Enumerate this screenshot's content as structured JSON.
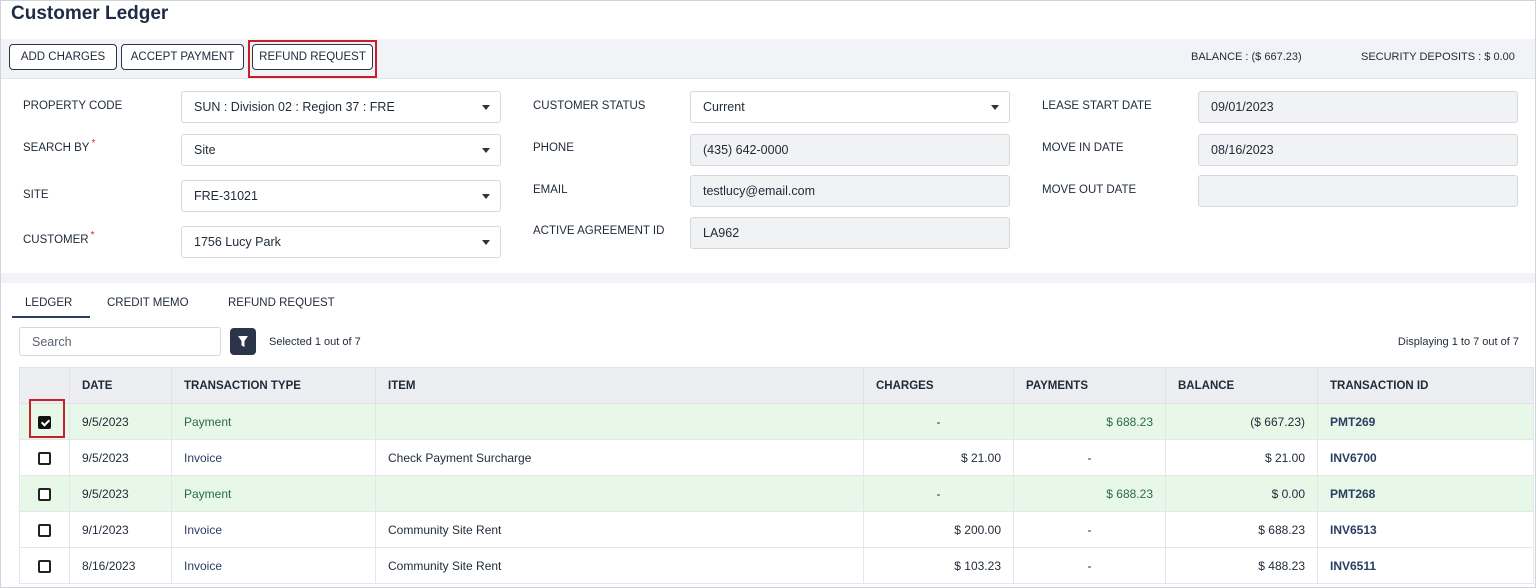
{
  "page": {
    "title": "Customer Ledger"
  },
  "toolbar": {
    "add_charges": "ADD CHARGES",
    "accept_payment": "ACCEPT PAYMENT",
    "refund_request": "REFUND REQUEST",
    "balance": "BALANCE : ($ 667.23)",
    "security_deposits": "SECURITY DEPOSITS : $ 0.00"
  },
  "form": {
    "property_code": {
      "label": "PROPERTY CODE",
      "value": "SUN : Division 02 : Region 37 : FRE"
    },
    "search_by": {
      "label": "SEARCH BY",
      "value": "Site"
    },
    "site": {
      "label": "SITE",
      "value": "FRE-31021"
    },
    "customer": {
      "label": "CUSTOMER",
      "value": "1756 Lucy Park"
    },
    "customer_status": {
      "label": "CUSTOMER STATUS",
      "value": "Current"
    },
    "phone": {
      "label": "PHONE",
      "value": "(435) 642-0000"
    },
    "email": {
      "label": "EMAIL",
      "value": "testlucy@email.com"
    },
    "active_agreement_id": {
      "label": "ACTIVE AGREEMENT ID",
      "value": "LA962"
    },
    "lease_start_date": {
      "label": "LEASE START DATE",
      "value": "09/01/2023"
    },
    "move_in_date": {
      "label": "MOVE IN DATE",
      "value": "08/16/2023"
    },
    "move_out_date": {
      "label": "MOVE OUT DATE",
      "value": ""
    },
    "required_marker": "*"
  },
  "tabs": [
    {
      "label": "LEDGER",
      "active": true
    },
    {
      "label": "CREDIT MEMO",
      "active": false
    },
    {
      "label": "REFUND REQUEST",
      "active": false
    }
  ],
  "grid_toolbar": {
    "search_placeholder": "Search",
    "selected_info": "Selected 1 out of 7",
    "display_info": "Displaying 1 to 7 out of 7"
  },
  "table": {
    "columns": [
      "DATE",
      "TRANSACTION TYPE",
      "ITEM",
      "CHARGES",
      "PAYMENTS",
      "BALANCE",
      "TRANSACTION ID"
    ],
    "rows": [
      {
        "checked": true,
        "date": "9/5/2023",
        "type": "Payment",
        "item": "",
        "charges": "-",
        "payments": "$ 688.23",
        "balance": "($ 667.23)",
        "txid": "PMT269"
      },
      {
        "checked": false,
        "date": "9/5/2023",
        "type": "Invoice",
        "item": "Check Payment Surcharge",
        "charges": "$ 21.00",
        "payments": "-",
        "balance": "$ 21.00",
        "txid": "INV6700"
      },
      {
        "checked": false,
        "date": "9/5/2023",
        "type": "Payment",
        "item": "",
        "charges": "-",
        "payments": "$ 688.23",
        "balance": "$ 0.00",
        "txid": "PMT268"
      },
      {
        "checked": false,
        "date": "9/1/2023",
        "type": "Invoice",
        "item": "Community Site Rent",
        "charges": "$ 200.00",
        "payments": "-",
        "balance": "$ 688.23",
        "txid": "INV6513"
      },
      {
        "checked": false,
        "date": "8/16/2023",
        "type": "Invoice",
        "item": "Community Site Rent",
        "charges": "$ 103.23",
        "payments": "-",
        "balance": "$ 488.23",
        "txid": "INV6511"
      }
    ]
  },
  "colors": {
    "highlight": "#c8202a",
    "payment_row": "#e7f7e8",
    "accent": "#2b3d63"
  }
}
